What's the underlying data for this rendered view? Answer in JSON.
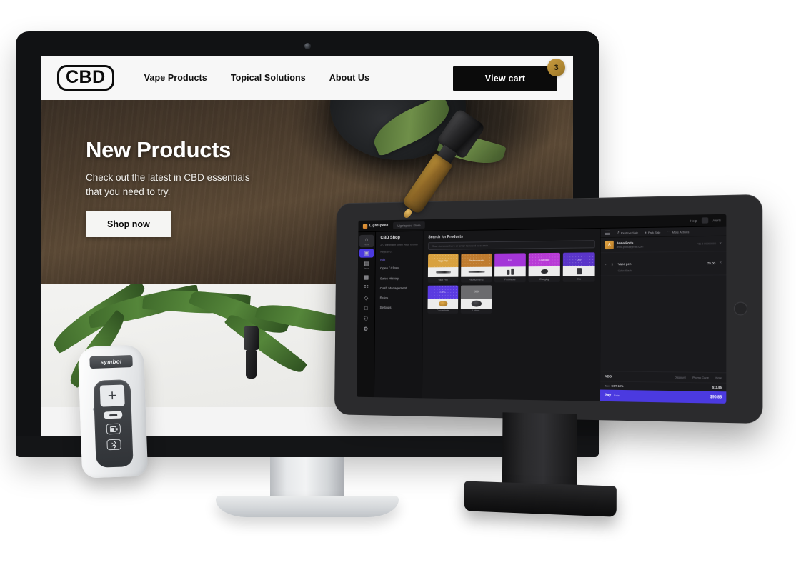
{
  "scene": {
    "title": "CBD retail hardware mockup",
    "devices": [
      "desktop-monitor",
      "tablet-pos-terminal",
      "barcode-scanner"
    ]
  },
  "website": {
    "logo_text": "CBD",
    "nav": [
      {
        "label": "Vape Products"
      },
      {
        "label": "Topical Solutions"
      },
      {
        "label": "About Us"
      }
    ],
    "cart": {
      "label": "View cart",
      "badge_count": "3",
      "badge_color": "#b4892f"
    },
    "hero": {
      "title": "New Products",
      "subtitle": "Check out the latest in CBD essentials that you need to try.",
      "cta_label": "Shop now"
    }
  },
  "pos": {
    "topbar": {
      "brand": "Lightspeed",
      "store_tab": "Lightspeed Store",
      "actions": [
        {
          "label": "Help"
        },
        {
          "label": "Alerts"
        }
      ]
    },
    "rail": [
      {
        "icon": "home-icon",
        "glyph": "⌂",
        "label": "Home"
      },
      {
        "icon": "sell-icon",
        "glyph": "▣",
        "label": "Sell"
      },
      {
        "icon": "inventory-icon",
        "glyph": "▤",
        "label": "Items"
      },
      {
        "icon": "reports-icon",
        "glyph": "▦",
        "label": "Reports"
      },
      {
        "icon": "chart-icon",
        "glyph": "☷",
        "label": "Insights"
      },
      {
        "icon": "tag-icon",
        "glyph": "◇",
        "label": "Catalog"
      },
      {
        "icon": "orders-icon",
        "glyph": "□",
        "label": "Orders"
      },
      {
        "icon": "customers-icon",
        "glyph": "⚇",
        "label": "People"
      },
      {
        "icon": "settings-icon",
        "glyph": "⚙",
        "label": "Setup"
      }
    ],
    "menu": {
      "shop_name": "CBD Shop",
      "address": "277 Wellington Street West Toronto",
      "status": "Register 01",
      "link": "Edit",
      "items": [
        {
          "label": "Open / Close"
        },
        {
          "label": "Sales History"
        },
        {
          "label": "Cash Management"
        },
        {
          "label": "Rules"
        },
        {
          "label": "Settings"
        }
      ]
    },
    "products": {
      "heading": "Search for Products",
      "search_placeholder": "Scan barcode here or enter keyword to search...",
      "tiles": [
        {
          "label": "Vape Pen",
          "cap": "Vape Pen",
          "color": "#d8a13f",
          "silhouette": "pen"
        },
        {
          "label": "Replacements",
          "cap": "Replacements",
          "color": "#c07c2e",
          "silhouette": "pen-thin"
        },
        {
          "label": "Pod Vapes",
          "cap": "Pod",
          "color": "#a435d8",
          "silhouette": "bottles"
        },
        {
          "label": "Charging",
          "cap": "Charging",
          "color": "#b83ad6",
          "silhouette": "blob"
        },
        {
          "label": "Oils",
          "cap": "Oils",
          "color": "#5a35c9",
          "silhouette": "stack"
        },
        {
          "label": "Concentrate",
          "cap": "Conc.",
          "color": "#5a3ae0",
          "silhouette": "coin"
        },
        {
          "label": "Lotions",
          "cap": "CBD",
          "color": "#6b6b6e",
          "silhouette": "ring"
        }
      ]
    },
    "cart": {
      "actions": [
        {
          "icon": "retrieve-icon",
          "glyph": "↺",
          "label": "Retrieve Sale"
        },
        {
          "icon": "park-icon",
          "glyph": "⏸",
          "label": "Park Sale"
        },
        {
          "icon": "more-icon",
          "glyph": "⋯",
          "label": "More Actions"
        }
      ],
      "customer": {
        "avatar_initial": "A",
        "name": "Anna Potts",
        "phone": "+61 2 0000 0000",
        "email": "anna.potts@gmail.com",
        "remove": "✕"
      },
      "lines": [
        {
          "qty": "1",
          "name": "Vape pen",
          "variant": "Color: Black",
          "price": "79.00",
          "remove": "✕"
        }
      ],
      "footer": {
        "add_label": "ADD",
        "options": [
          {
            "label": "Discount"
          },
          {
            "label": "Promo Code"
          },
          {
            "label": "Note"
          }
        ],
        "tax_prefix": "Tax:",
        "tax_label": "GST 15%",
        "tax_amount": "$11.85",
        "pay_label": "Pay",
        "pay_sub": "Enter",
        "pay_amount": "$90.85"
      }
    }
  },
  "scanner": {
    "brand": "symbol",
    "keys": [
      {
        "name": "plus-button",
        "glyph": "+"
      },
      {
        "name": "minus-button",
        "glyph": "–"
      },
      {
        "name": "battery-button",
        "glyph": "▮"
      },
      {
        "name": "bluetooth-button",
        "glyph": "ᛗ"
      }
    ]
  }
}
